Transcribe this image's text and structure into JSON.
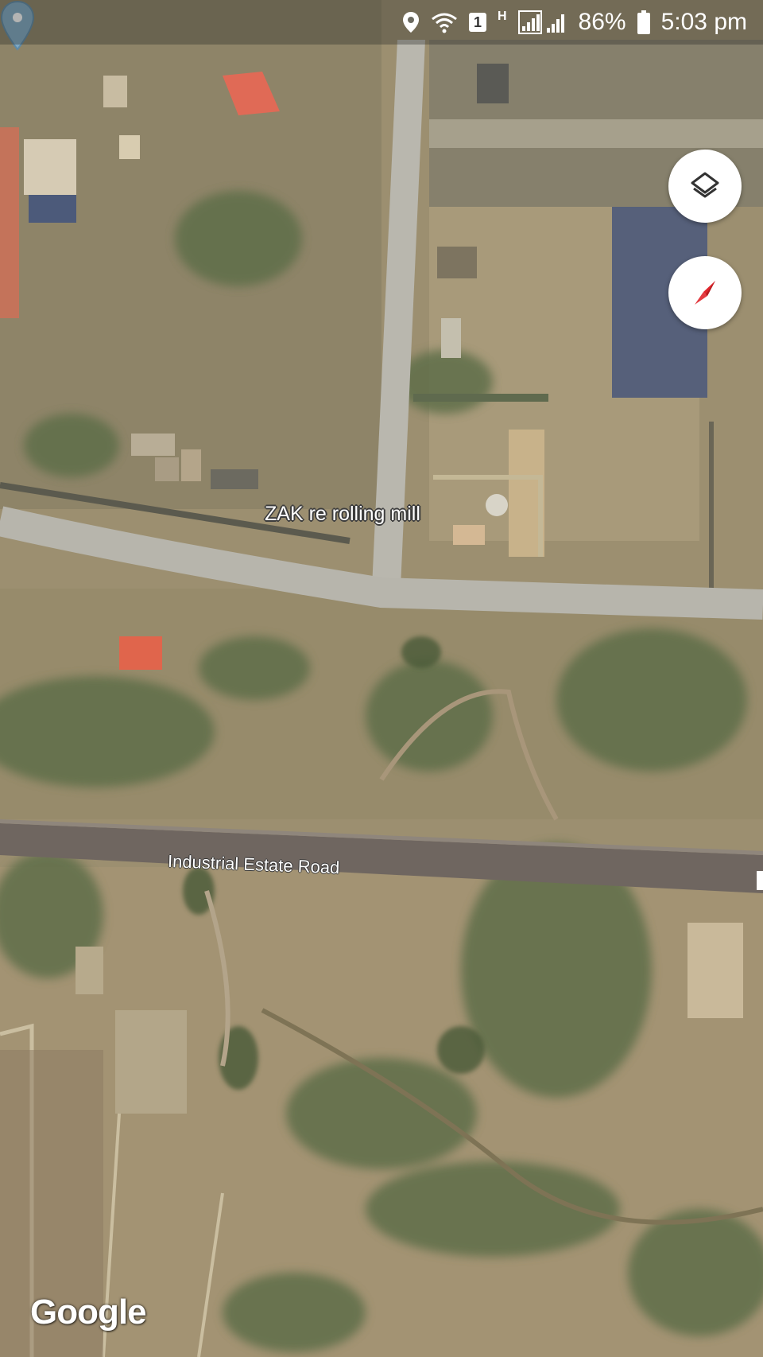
{
  "status_bar": {
    "location_icon": "location-pin-icon",
    "wifi_icon": "wifi-icon",
    "sim_badge": "1",
    "network_type": "H",
    "signal_icon": "signal-bars-icon",
    "battery_percent": "86%",
    "battery_icon": "battery-icon",
    "time": "5:03 pm"
  },
  "map": {
    "view": "satellite",
    "place_label": "ZAK re rolling mill",
    "road_label": "Industrial Estate Road",
    "attribution": "Google",
    "pin_color": "#7fa9c4"
  },
  "controls": {
    "layers_icon": "layers-icon",
    "compass_icon": "compass-icon",
    "compass_needle_color": "#e0262c"
  }
}
